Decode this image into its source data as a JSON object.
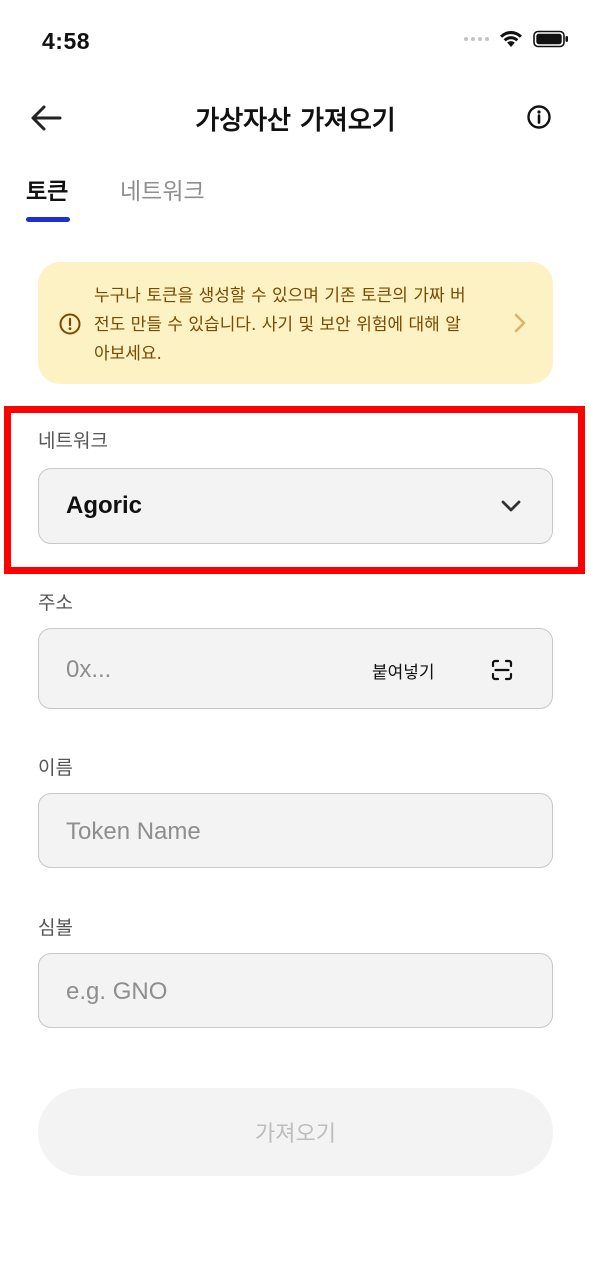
{
  "status_bar": {
    "time": "4:58"
  },
  "header": {
    "title": "가상자산 가져오기"
  },
  "tabs": [
    {
      "label": "토큰",
      "active": true
    },
    {
      "label": "네트워크",
      "active": false
    }
  ],
  "warning": {
    "line1": "누구나 토큰을 생성할 수 있으며 기존 토큰의 가짜 버",
    "line2": "전도 만들 수 있습니다. 사기 및 보안 위험에 대해 알",
    "line3": "아보세요."
  },
  "form": {
    "network": {
      "label": "네트워크",
      "value": "Agoric"
    },
    "address": {
      "label": "주소",
      "placeholder": "0x...",
      "paste_label": "붙여넣기"
    },
    "name": {
      "label": "이름",
      "placeholder": "Token Name"
    },
    "symbol": {
      "label": "심볼",
      "placeholder": "e.g. GNO"
    }
  },
  "submit": {
    "label": "가져오기"
  },
  "colors": {
    "accent": "#1d2fd6",
    "warning_bg": "#fdf2c4",
    "warning_text": "#7a4a00",
    "highlight": "#ff0000"
  },
  "icons": {
    "back": "arrow-left-icon",
    "info": "info-icon",
    "warning": "alert-circle-icon",
    "chevron_right": "chevron-right-icon",
    "chevron_down": "chevron-down-icon",
    "scan": "scan-icon",
    "wifi": "wifi-icon",
    "battery": "battery-icon"
  }
}
